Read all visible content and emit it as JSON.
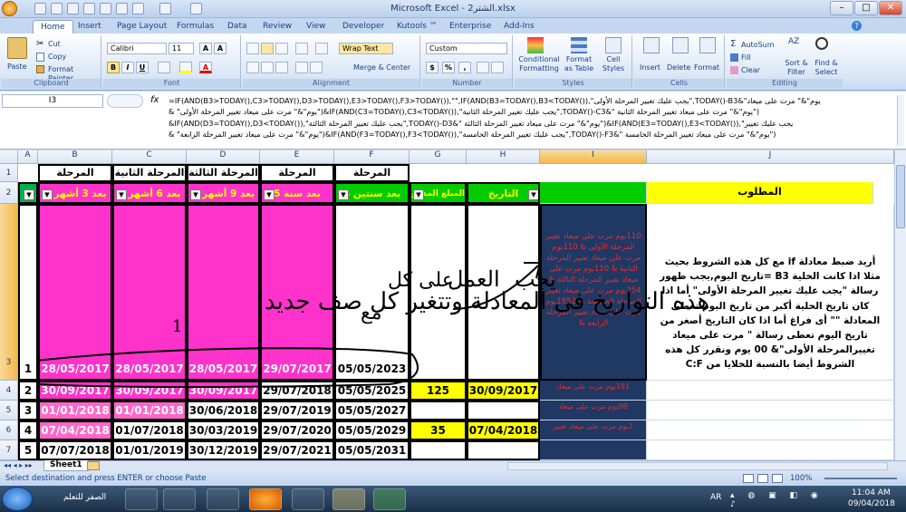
{
  "window": {
    "title": "Microsoft Excel - الشتر2.xlsx",
    "min": "–",
    "max": "□",
    "close": "✕"
  },
  "tabs": [
    "Home",
    "Insert",
    "Page Layout",
    "Formulas",
    "Data",
    "Review",
    "View",
    "Developer",
    "Kutools ™",
    "Enterprise",
    "Add-Ins"
  ],
  "clipboard": {
    "paste": "Paste",
    "cut": "Cut",
    "copy": "Copy",
    "painter": "Format Painter",
    "label": "Clipboard"
  },
  "font": {
    "name": "Calibri",
    "size": "11",
    "label": "Font",
    "bold": "B",
    "italic": "I",
    "underline": "U",
    "grow": "A",
    "shrink": "A",
    "color": "A"
  },
  "alignment": {
    "wrap": "Wrap Text",
    "merge": "Merge & Center",
    "label": "Alignment"
  },
  "number": {
    "format": "Custom",
    "currency": "$",
    "percent": "%",
    "comma": ",",
    "label": "Number"
  },
  "styles": {
    "conditional": "Conditional Formatting",
    "table": "Format as Table",
    "cell": "Cell Styles",
    "label": "Styles"
  },
  "cells": {
    "insert": "Insert",
    "delete": "Delete",
    "format": "Format",
    "label": "Cells"
  },
  "editing": {
    "autosum": "AutoSum",
    "fill": "Fill",
    "clear": "Clear",
    "sort": "Sort & Filter",
    "find": "Find & Select",
    "label": "Editing"
  },
  "formula_bar": {
    "name_box": "I3",
    "fx": "fx",
    "text": "=IF(AND(B3>TODAY(),C3>TODAY(),D3>TODAY(),E3>TODAY(),F3>TODAY()),\"\",IF(AND(B3=TODAY(),B3<TODAY()),\"يجب عليك تغيير المرحلة الأولى\",TODAY()-B3&\"يوم\"&\" مرت على ميعاد \n& \"يوم\"&\" مرت على ميعاد تغيير المرحلة الأولى\")&IF(AND(C3=TODAY(),C3<TODAY()),\"يجب عليك تغيير المرحلة الثانية\",TODAY()-C3&\" يوم\"&\" مرت على ميعاد تغيير المرحلة الثانية\")\n&IF(AND(D3=TODAY(),D3<TODAY()),\"يجب عليك تغيير المرحلة الثالثة\",TODAY()-D3&\" يوم\"&\" مرت على ميعاد تغيير المرحلة الثالثة\")&IF(AND(E3=TODAY(),E3<TODAY()),\"يجب عليك تغيير\n& \"يوم\"&\" مرت على ميعاد تغيير المرحلة الرابعة\")&IF(AND(F3=TODAY(),F3<TODAY()),\"يجب عليك تغيير المرحلة الخامسة\",TODAY()-F3&\" يوم\"&\" مرت على ميعاد تغيير المرحلة الخامسة\")"
  },
  "columns": [
    "A",
    "B",
    "C",
    "D",
    "E",
    "F",
    "G",
    "H",
    "I",
    "J"
  ],
  "rows": [
    "1",
    "2",
    "3",
    "4",
    "5",
    "6",
    "7"
  ],
  "row1": {
    "B": "المرحلة الأولى",
    "C": "المرحلة الثانية",
    "D": "المرحلة الثالثة",
    "E": "المرحلة الخامسة",
    "F": "المرحلة الرابعة"
  },
  "row2": {
    "A": "",
    "B": "بعد 3 أشهر 1",
    "C": "بعد 6 أشهر 2",
    "D": "بعد 9 أشهر 3",
    "E": "بعد سنة 5",
    "F": "بعد سنتين 4",
    "G": "المبلغ المدفوع",
    "H": "التاريخ",
    "J": "المطلوب"
  },
  "data_rows": [
    {
      "A": "1",
      "B": "28/05/2017",
      "C": "28/05/2017",
      "D": "28/05/2017",
      "E": "29/07/2017",
      "F": "05/05/2023",
      "G": "",
      "H": ""
    },
    {
      "A": "2",
      "B": "30/09/2017",
      "C": "30/09/2017",
      "D": "30/09/2017",
      "E": "29/07/2018",
      "F": "05/05/2025",
      "G": "125",
      "H": "30/09/2017"
    },
    {
      "A": "3",
      "B": "01/01/2018",
      "C": "01/01/2018",
      "D": "30/06/2018",
      "E": "29/07/2019",
      "F": "05/05/2027",
      "G": "",
      "H": ""
    },
    {
      "A": "4",
      "B": "07/04/2018",
      "C": "01/07/2018",
      "D": "30/03/2019",
      "E": "29/07/2020",
      "F": "05/05/2029",
      "G": "35",
      "H": "07/04/2018"
    },
    {
      "A": "5",
      "B": "07/07/2018",
      "C": "01/01/2019",
      "D": "30/12/2019",
      "E": "29/07/2021",
      "F": "05/05/2031",
      "G": "",
      "H": ""
    }
  ],
  "i3_text": "110يوم مرت على ميعاد تغيير المرحلة الأولى & 110يوم مرت على ميعاد تغيير المرحلة الثانية & 110يوم مرت على ميعاد تغيير المرحلة الثالثة & 254يوم مرت على ميعاد تغيير المرحلة الخامسة & 1852يوم مرت على ميعاد تغيير المرحلة الرابعة &",
  "i4_text": "191يوم مرت على ميعاد",
  "i5_text": "98يوم مرت على ميعاد",
  "i6_text": "2يوم مرت على ميعاد تغيير",
  "j3_text": "أريد ضبط معادلة if مع كل هذه الشروط بحيث مثلا اذا كانت الخلية B3 =تاريخ اليوم,يجب ظهور رسالة \"يجب عليك تغيير المرحلة الأولى\" أما اذا كان تاريخ الخلية أكبر من تاريخ اليوم تعطى المعادلة \"\" أى فراغ أما اذا كان التاريخ أصغر من تاريخ اليوم تعطى رسالة \" مرت على ميعاد تغييرالمرحلة الأولى\"& 00 يوم ونقرر كل هذه الشروط أيضا بالنسبة للخلايا من C:F",
  "handwriting": {
    "a": "هذه التواريخ فى المعادلة وتتغير كل صف جديد",
    "b": "على كل",
    "c": "مع",
    "d": "العمل",
    "e": "يجب",
    "f": "1"
  },
  "sheet_tab": "Sheet1",
  "status": {
    "text": "Select destination and press ENTER or choose Paste",
    "zoom": "100%"
  },
  "taskbar": {
    "lang": "AR",
    "time": "11:04 AM",
    "date": "09/04/2018",
    "start_label": "الصفر للتعلم"
  },
  "colors": {
    "magenta": "#ff33cc",
    "pink": "#ff66cc",
    "yellow": "#ffff00",
    "green": "#00cc00",
    "navy": "#1f3864",
    "selection": "#c9daf0"
  }
}
